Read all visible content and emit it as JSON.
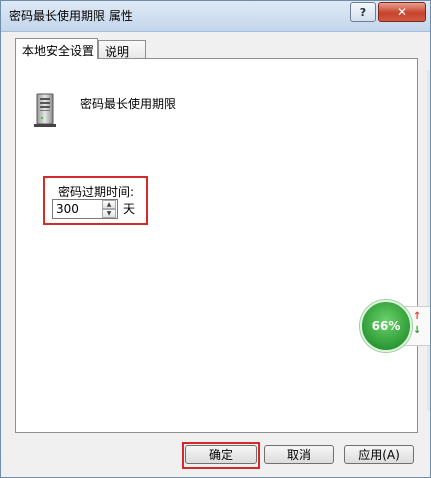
{
  "window": {
    "title": "密码最长使用期限 属性"
  },
  "titlebar_buttons": {
    "help_glyph": "?",
    "close_glyph": "✕"
  },
  "tabs": [
    {
      "label": "本地安全设置",
      "active": true
    },
    {
      "label": "说明",
      "active": false
    }
  ],
  "policy": {
    "icon": "server-icon",
    "title": "密码最长使用期限"
  },
  "password_expiry": {
    "label": "密码过期时间:",
    "value": "300",
    "unit": "天"
  },
  "gauge": {
    "percent_label": "66%",
    "up_arrow": "↑",
    "down_arrow": "↓",
    "color": "#2c9a35"
  },
  "buttons": {
    "ok": "确定",
    "cancel": "取消",
    "apply": "应用(A)"
  },
  "colors": {
    "highlight": "#d42a2a",
    "close_button": "#c7432f"
  }
}
